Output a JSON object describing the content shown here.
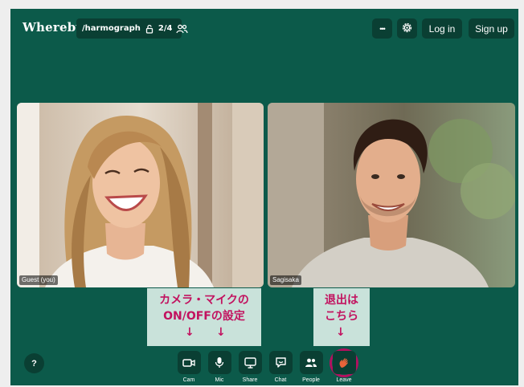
{
  "header": {
    "logo": "Whereby",
    "room_name": "/harmograph",
    "participant_count": "2/4",
    "more_label": "•••",
    "login_label": "Log in",
    "signup_label": "Sign up"
  },
  "participants": [
    {
      "name": "Guest (you)"
    },
    {
      "name": "Sagisaka"
    }
  ],
  "annotations": {
    "camera_mic": {
      "line1": "カメラ・マイクの",
      "line2": "ON/OFFの設定",
      "arrow": "↓"
    },
    "leave": {
      "line1": "退出は",
      "line2": "こちら",
      "arrow": "↓"
    }
  },
  "controls": {
    "help": "?",
    "cam": "Cam",
    "mic": "Mic",
    "share": "Share",
    "chat": "Chat",
    "people": "People",
    "leave": "Leave"
  },
  "colors": {
    "background": "#0c5a4a",
    "button": "#0a3f33",
    "annotation_bg": "#c9e2da",
    "annotation_text": "#c2125f",
    "leave_accent": "#e8643a"
  }
}
